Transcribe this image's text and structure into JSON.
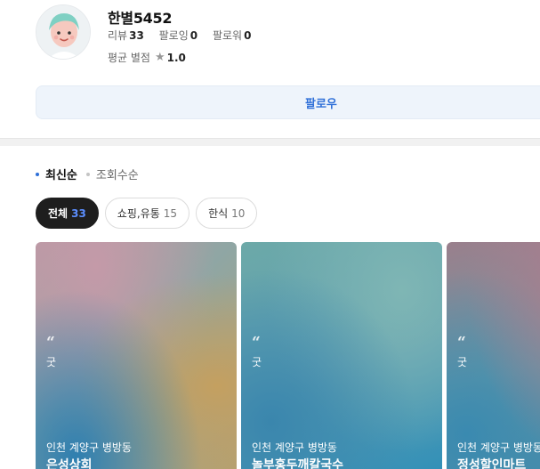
{
  "profile": {
    "name": "한별5452",
    "stats": [
      {
        "label": "리뷰",
        "value": "33"
      },
      {
        "label": "팔로잉",
        "value": "0"
      },
      {
        "label": "팔로워",
        "value": "0"
      }
    ],
    "rating_label": "평균 별점",
    "rating_value": "1.0",
    "follow_label": "팔로우"
  },
  "sort": {
    "options": [
      {
        "label": "최신순",
        "active": true
      },
      {
        "label": "조회수순",
        "active": false
      }
    ]
  },
  "filters": [
    {
      "label": "전체",
      "count": "33",
      "active": true
    },
    {
      "label": "쇼핑,유통",
      "count": "15",
      "active": false
    },
    {
      "label": "한식",
      "count": "10",
      "active": false
    }
  ],
  "cards": [
    {
      "quote": "“",
      "snippet": "굿",
      "location": "인천 계양구 병방동",
      "title": "은성상회"
    },
    {
      "quote": "“",
      "snippet": "굿",
      "location": "인천 계양구 병방동",
      "title": "놀부홍두깨칼국수"
    },
    {
      "quote": "“",
      "snippet": "굿",
      "location": "인천 계양구 병방동",
      "title": "정성할인마트"
    }
  ],
  "colors": {
    "accent": "#2e6fd8",
    "active_chip": "#1e1e1e",
    "active_count": "#5b8eff",
    "sort_active_dot": "#2e6fd8",
    "sort_inactive_dot": "#c4c4c4"
  },
  "icons": {
    "avatar": "profile-avatar-icon",
    "star": "star-icon",
    "quote": "quote-icon"
  }
}
